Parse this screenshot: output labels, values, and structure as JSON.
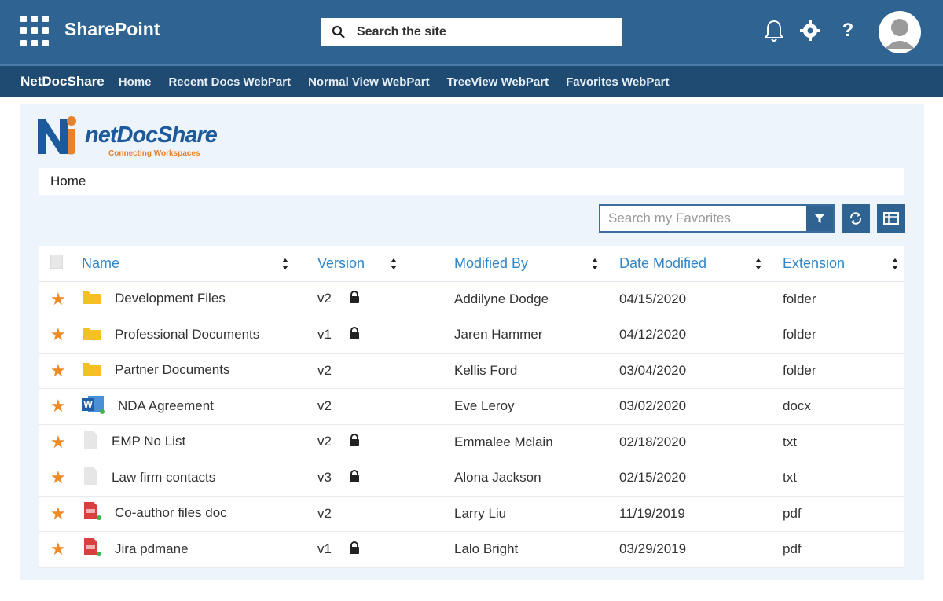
{
  "suitebar": {
    "brand": "SharePoint",
    "search_placeholder": "Search the site",
    "help_label": "?"
  },
  "nav": {
    "site_name": "NetDocShare",
    "links": [
      "Home",
      "Recent Docs WebPart",
      "Normal View WebPart",
      "TreeView WebPart",
      "Favorites WebPart"
    ]
  },
  "logo": {
    "name": "netDocShare",
    "tagline": "Connecting Workspaces"
  },
  "breadcrumb": "Home",
  "favorites": {
    "search_placeholder": "Search my Favorites"
  },
  "table": {
    "headers": {
      "name": "Name",
      "version": "Version",
      "modified_by": "Modified By",
      "date_modified": "Date Modified",
      "extension": "Extension"
    },
    "rows": [
      {
        "name": "Development Files",
        "version": "v2",
        "locked": true,
        "modified_by": "Addilyne Dodge",
        "date": "04/15/2020",
        "ext": "folder",
        "icon": "folder-icon"
      },
      {
        "name": "Professional Documents",
        "version": "v1",
        "locked": true,
        "modified_by": "Jaren Hammer",
        "date": "04/12/2020",
        "ext": "folder",
        "icon": "folder-icon"
      },
      {
        "name": "Partner Documents",
        "version": "v2",
        "locked": false,
        "modified_by": "Kellis Ford",
        "date": "03/04/2020",
        "ext": "folder",
        "icon": "folder-icon"
      },
      {
        "name": "NDA Agreement",
        "version": "v2",
        "locked": false,
        "modified_by": "Eve Leroy",
        "date": "03/02/2020",
        "ext": "docx",
        "icon": "word-icon"
      },
      {
        "name": "EMP No List",
        "version": "v2",
        "locked": true,
        "modified_by": "Emmalee Mclain",
        "date": "02/18/2020",
        "ext": "txt",
        "icon": "text-file-icon"
      },
      {
        "name": "Law firm contacts",
        "version": "v3",
        "locked": true,
        "modified_by": "Alona Jackson",
        "date": "02/15/2020",
        "ext": "txt",
        "icon": "text-file-icon"
      },
      {
        "name": "Co-author files doc",
        "version": "v2",
        "locked": false,
        "modified_by": "Larry Liu",
        "date": "11/19/2019",
        "ext": "pdf",
        "icon": "pdf-icon"
      },
      {
        "name": "Jira pdmane",
        "version": "v1",
        "locked": true,
        "modified_by": "Lalo Bright",
        "date": "03/29/2019",
        "ext": "pdf",
        "icon": "pdf-icon"
      }
    ]
  },
  "colors": {
    "suitebar": "#2f6391",
    "navbar": "#1f4a72",
    "accent": "#2f86c9",
    "star": "#f08a24",
    "panel": "#eef4fb"
  }
}
